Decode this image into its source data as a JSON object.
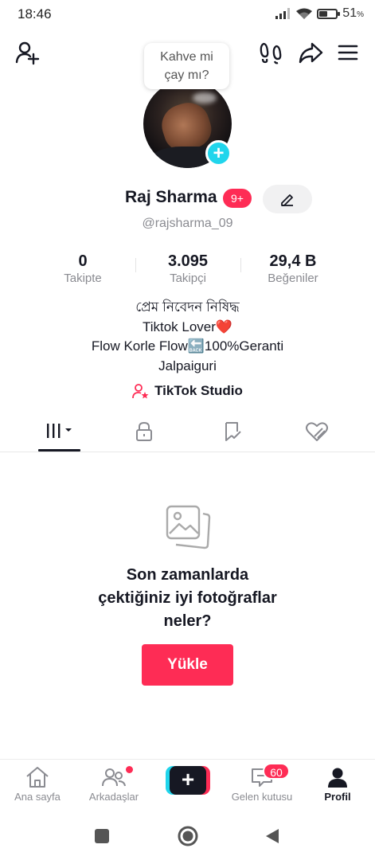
{
  "status_bar": {
    "time": "18:46",
    "battery_percent": "51",
    "battery_unit": "%",
    "battery_level": 0.51
  },
  "bubble": {
    "line1": "Kahve mi",
    "line2": "çay mı?"
  },
  "profile": {
    "name": "Raj Sharma",
    "notification_badge": "9+",
    "username": "@rajsharma_09"
  },
  "stats": [
    {
      "value": "0",
      "label": "Takipte"
    },
    {
      "value": "3.095",
      "label": "Takipçi"
    },
    {
      "value": "29,4 B",
      "label": "Beğeniler"
    }
  ],
  "bio": [
    "প্রেম নিবেদন নিষিদ্ধ",
    "Tiktok Lover❤️",
    "Flow Korle Flow🔙100%Geranti",
    "Jalpaiguri"
  ],
  "studio": {
    "label": "TikTok Studio"
  },
  "tabs": {
    "icons": [
      "videos-grid-icon",
      "lock-icon",
      "repost-icon",
      "liked-icon"
    ],
    "active_index": 0
  },
  "empty_state": {
    "line1": "Son zamanlarda",
    "line2": "çektiğiniz iyi fotoğraflar",
    "line3": "neler?",
    "button_label": "Yükle"
  },
  "bottom_nav": {
    "home": "Ana sayfa",
    "friends": "Arkadaşlar",
    "inbox": "Gelen kutusu",
    "inbox_badge": "60",
    "profile": "Profil"
  },
  "colors": {
    "accent": "#fe2c55",
    "cyan": "#20d5ec",
    "text": "#161823",
    "muted": "#8a8b91"
  }
}
